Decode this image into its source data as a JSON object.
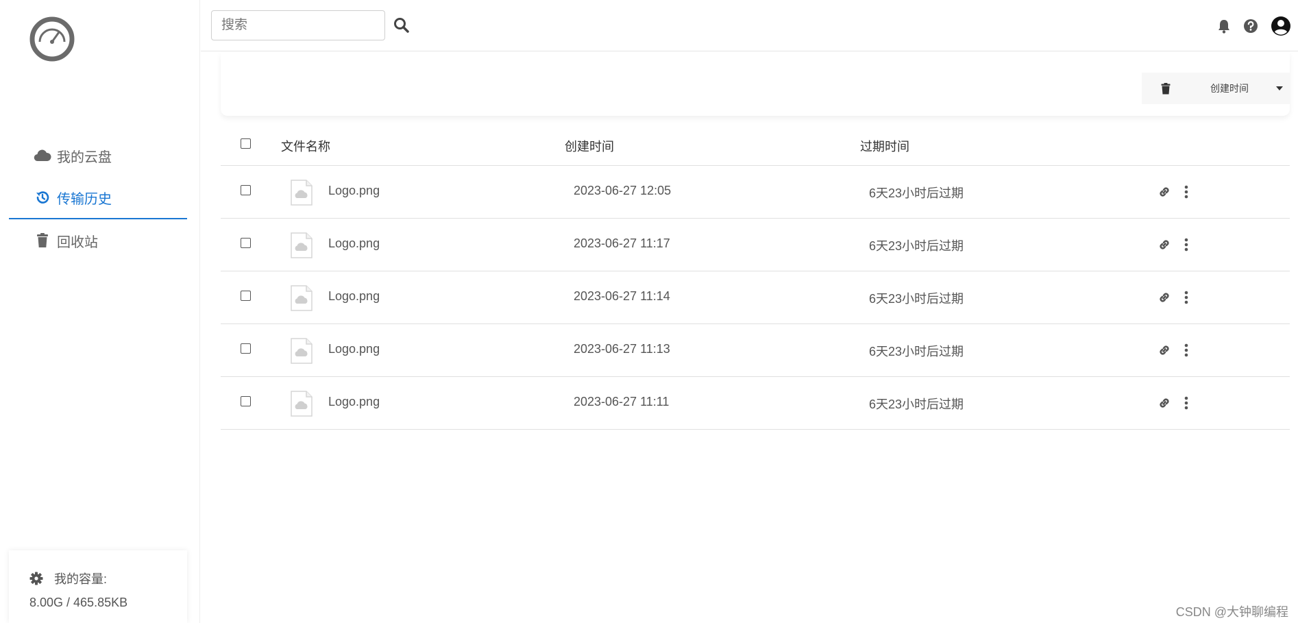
{
  "header": {
    "search_placeholder": "搜索",
    "icons": [
      "search-icon",
      "bell-icon",
      "help-icon",
      "account-icon"
    ]
  },
  "sidebar": {
    "logo_icon": "speedometer-logo",
    "items": [
      {
        "label": "我的云盘",
        "icon": "cloud-icon",
        "active": false
      },
      {
        "label": "传输历史",
        "icon": "history-icon",
        "active": true
      },
      {
        "label": "回收站",
        "icon": "trash-icon",
        "active": false
      }
    ],
    "capacity": {
      "label": "我的容量:",
      "value": "8.00G / 465.85KB",
      "icon": "gear-icon"
    }
  },
  "toolbar": {
    "sort_label": "创建时间",
    "delete_icon": "trash-icon",
    "dropdown_icon": "caret-down-icon"
  },
  "table": {
    "headers": {
      "name": "文件名称",
      "created": "创建时间",
      "expires": "过期时间"
    },
    "rows": [
      {
        "name": "Logo.png",
        "created": "2023-06-27 12:05",
        "expires": "6天23小时后过期"
      },
      {
        "name": "Logo.png",
        "created": "2023-06-27 11:17",
        "expires": "6天23小时后过期"
      },
      {
        "name": "Logo.png",
        "created": "2023-06-27 11:14",
        "expires": "6天23小时后过期"
      },
      {
        "name": "Logo.png",
        "created": "2023-06-27 11:13",
        "expires": "6天23小时后过期"
      },
      {
        "name": "Logo.png",
        "created": "2023-06-27 11:11",
        "expires": "6天23小时后过期"
      }
    ]
  },
  "watermark": "CSDN @大钟聊编程",
  "colors": {
    "accent": "#1976d2",
    "text": "#333333",
    "muted": "#666666",
    "border": "#e0e0e0"
  }
}
